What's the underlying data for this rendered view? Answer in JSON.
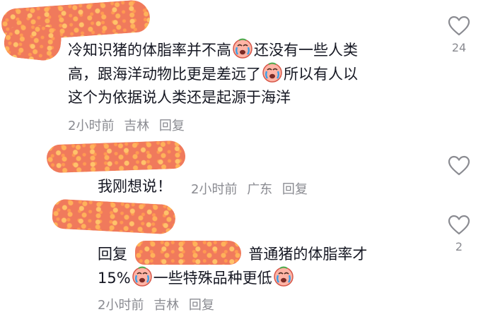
{
  "comments": [
    {
      "text_lines": [
        "冷知识猪的体脂率并不高",
        "还没有一些人类",
        "高，跟海洋动物比更是差远了",
        "所以有人以",
        "这个为依据说人类还是起源于海洋"
      ],
      "meta": {
        "time": "2小时前",
        "location": "吉林",
        "reply": "回复"
      },
      "likes": "24"
    },
    {
      "text": "我刚想说！",
      "meta": {
        "time": "2小时前",
        "location": "广东",
        "reply": "回复"
      },
      "likes": ""
    },
    {
      "reply_prefix": "回复",
      "text_lines": [
        "普通猪的体脂率才",
        "15%",
        "一些特殊品种更低"
      ],
      "meta": {
        "time": "2小时前",
        "location": "吉林",
        "reply": "回复"
      },
      "likes": "2"
    }
  ],
  "icons": {
    "like": "heart-outline-icon",
    "emoji": "crying-face-icon"
  },
  "colors": {
    "text": "#161823",
    "meta": "#8a8b91",
    "icon": "#8a8b91",
    "redaction": "#f07a5c"
  }
}
